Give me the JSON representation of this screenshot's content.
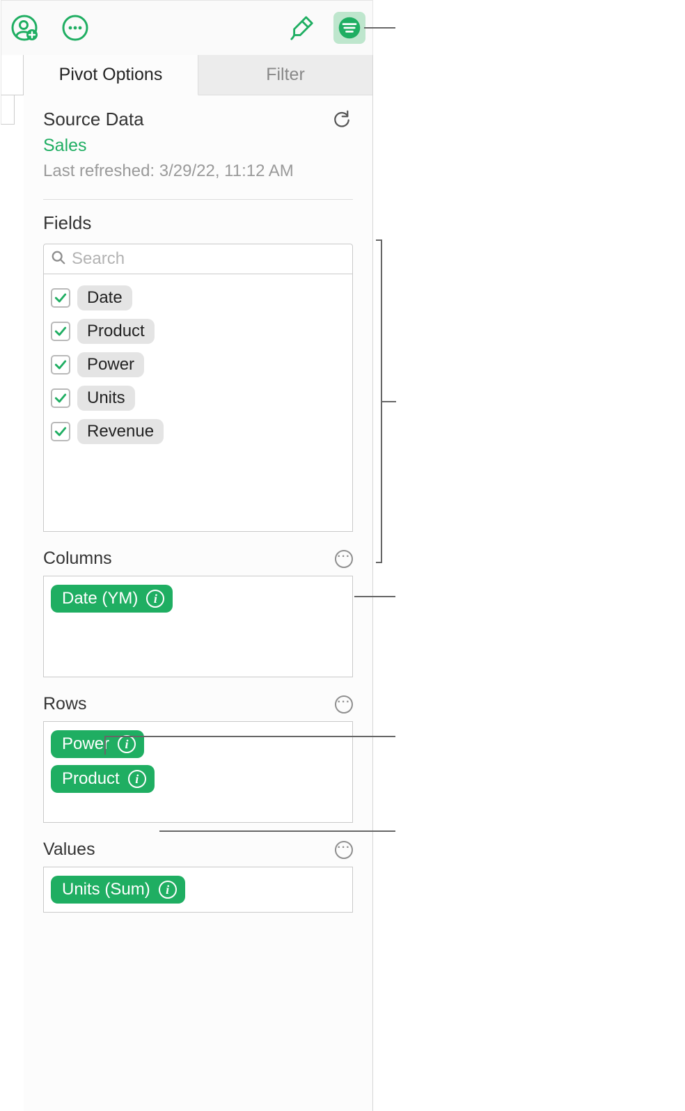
{
  "tabs": {
    "pivot": "Pivot Options",
    "filter": "Filter"
  },
  "source": {
    "heading": "Source Data",
    "table": "Sales",
    "refreshed": "Last refreshed: 3/29/22, 11:12 AM"
  },
  "fields": {
    "heading": "Fields",
    "search_placeholder": "Search",
    "items": [
      "Date",
      "Product",
      "Power",
      "Units",
      "Revenue"
    ]
  },
  "columns": {
    "heading": "Columns",
    "pills": [
      "Date (YM)"
    ]
  },
  "rows": {
    "heading": "Rows",
    "pills": [
      "Power",
      "Product"
    ]
  },
  "values": {
    "heading": "Values",
    "pills": [
      "Units (Sum)"
    ]
  }
}
